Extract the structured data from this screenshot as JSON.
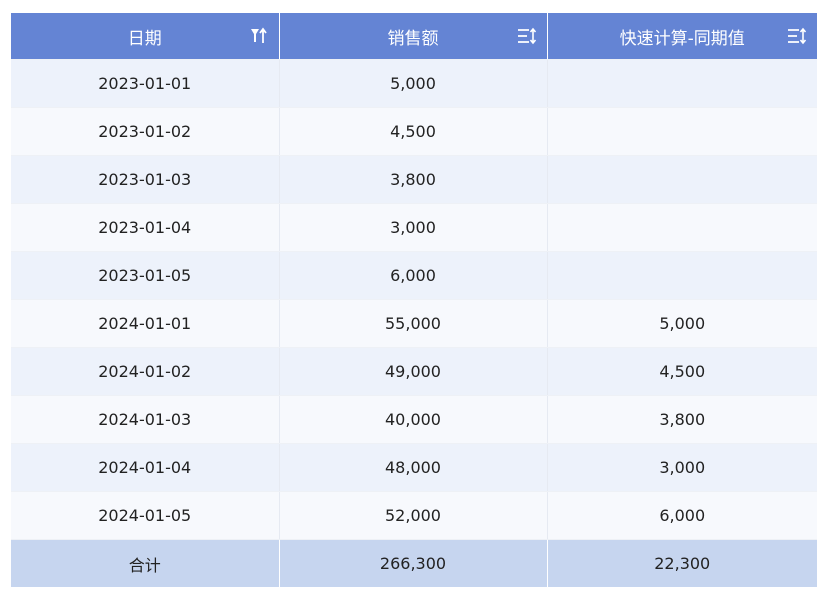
{
  "table": {
    "headers": [
      {
        "label": "日期",
        "icon": "filter-sort-icon"
      },
      {
        "label": "销售额",
        "icon": "sort-icon"
      },
      {
        "label": "快速计算-同期值",
        "icon": "sort-icon"
      }
    ],
    "rows": [
      [
        "2023-01-01",
        "5,000",
        ""
      ],
      [
        "2023-01-02",
        "4,500",
        ""
      ],
      [
        "2023-01-03",
        "3,800",
        ""
      ],
      [
        "2023-01-04",
        "3,000",
        ""
      ],
      [
        "2023-01-05",
        "6,000",
        ""
      ],
      [
        "2024-01-01",
        "55,000",
        "5,000"
      ],
      [
        "2024-01-02",
        "49,000",
        "4,500"
      ],
      [
        "2024-01-03",
        "40,000",
        "3,800"
      ],
      [
        "2024-01-04",
        "48,000",
        "3,000"
      ],
      [
        "2024-01-05",
        "52,000",
        "6,000"
      ]
    ],
    "footer": [
      "合计",
      "266,300",
      "22,300"
    ]
  },
  "colors": {
    "header_bg": "#6484d4",
    "row_odd": "#edf2fb",
    "row_even": "#f7f9fd",
    "footer_bg": "#c6d5ef"
  }
}
